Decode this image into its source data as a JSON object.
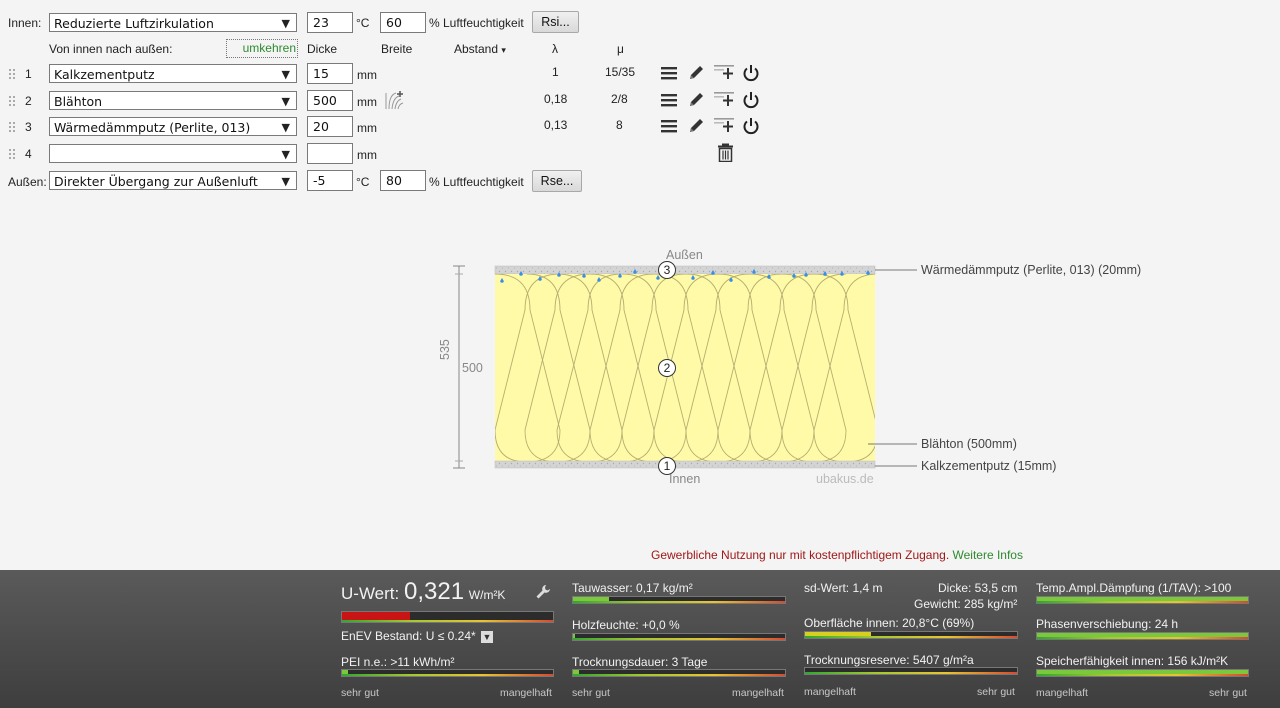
{
  "form": {
    "inside_label": "Innen:",
    "inside_select": "Reduzierte Luftzirkulation",
    "inside_temp": "23",
    "temp_unit": "°C",
    "inside_humidity": "60",
    "humidity_unit": "% Luftfeuchtigkeit",
    "rsi_button": "Rsi...",
    "direction_label": "Von innen nach außen:",
    "reverse_link": "umkehren",
    "col_dicke": "Dicke",
    "col_breite": "Breite",
    "col_abstand": "Abstand",
    "col_abstand_arrow": "▾",
    "col_lambda": "λ",
    "col_mu": "μ",
    "mm_unit": "mm",
    "outside_label": "Außen:",
    "outside_select": "Direkter Übergang zur Außenluft",
    "outside_temp": "-5",
    "outside_humidity": "80",
    "rse_button": "Rse...",
    "layers": [
      {
        "index": "1",
        "material": "Kalkzementputz",
        "thickness": "15",
        "lambda": "1",
        "mu": "15/35"
      },
      {
        "index": "2",
        "material": "Blähton",
        "thickness": "500",
        "lambda": "0,18",
        "mu": "2/8"
      },
      {
        "index": "3",
        "material": "Wärmedämmputz (Perlite, 013)",
        "thickness": "20",
        "lambda": "0,13",
        "mu": "8"
      },
      {
        "index": "4",
        "material": "",
        "thickness": "",
        "lambda": "",
        "mu": ""
      }
    ]
  },
  "diagram": {
    "top_label": "Außen",
    "bottom_label": "Innen",
    "watermark": "ubakus.de",
    "total_dim": "535",
    "layer_dim": "500",
    "marker_1": "1",
    "marker_2": "2",
    "marker_3": "3",
    "legend_top": "Wärmedämmputz (Perlite, 013) (20mm)",
    "legend_mid": "Blähton (500mm)",
    "legend_bottom": "Kalkzementputz (15mm)"
  },
  "notice": {
    "text": "Gewerbliche Nutzung nur mit kostenpflichtigem Zugang.",
    "link": "Weitere Infos",
    "text_color": "#a01818",
    "link_color": "#2e8a2e"
  },
  "results": {
    "u_label": "U-Wert:",
    "u_value": "0,321",
    "u_unit": "W/m²K",
    "enev": "EnEV Bestand: U ≤ 0.24*",
    "pei": "PEI n.e.: >11 kWh/m²",
    "tauwasser": "Tauwasser: 0,17 kg/m²",
    "holzfeuchte": "Holzfeuchte: +0,0 %",
    "trocknungsdauer": "Trocknungsdauer: 3 Tage",
    "sd_wert": "sd-Wert: 1,4 m",
    "dicke": "Dicke: 53,5 cm",
    "gewicht": "Gewicht: 285 kg/m²",
    "oberflaeche": "Oberfläche innen: 20,8°C (69%)",
    "trocknungsreserve": "Trocknungsreserve: 5407 g/m²a",
    "temp_ampl": "Temp.Ampl.Dämpfung (1/TAV): >100",
    "phasen": "Phasenverschiebung: 24 h",
    "speicher": "Speicherfähigkeit innen: 156 kJ/m²K",
    "scale_good": "sehr gut",
    "scale_bad": "mangelhaft",
    "bars": {
      "u_value": 0.32,
      "pei": 0.03,
      "tauwasser": 0.17,
      "holzfeuchte": 0.01,
      "trocknungsdauer": 0.03,
      "oberflaeche": 0.31,
      "trocknungsreserve": 0.0,
      "temp_ampl": 1.0,
      "phasen": 1.0,
      "speicher": 1.0
    }
  },
  "colors": {
    "bar_bad": "#c81414",
    "bar_good": "#7cc83c",
    "bar_yellow": "#d8d020",
    "layer_yellow": "#fffaa8",
    "accent_green": "#2e8a2e"
  }
}
